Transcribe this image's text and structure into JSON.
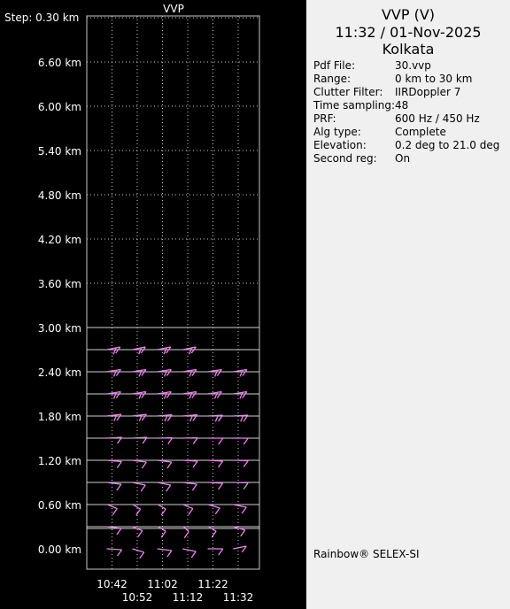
{
  "chart_data": {
    "type": "vvp_wind_barbs",
    "title": "VVP",
    "step_label": "Step: 0.30 km",
    "y_ticks": [
      "0.00 km",
      "0.60 km",
      "1.20 km",
      "1.80 km",
      "2.40 km",
      "3.00 km",
      "3.60 km",
      "4.20 km",
      "4.80 km",
      "5.40 km",
      "6.00 km",
      "6.60 km"
    ],
    "y_range_km": [
      0.0,
      7.2
    ],
    "x_ticks_top": [
      "10:42",
      "11:02",
      "11:22"
    ],
    "x_ticks_bottom": [
      "10:52",
      "11:12",
      "11:32"
    ],
    "times": [
      "10:42",
      "10:52",
      "11:02",
      "11:12",
      "11:22",
      "11:32"
    ],
    "heights_km": [
      0.0,
      0.3,
      0.6,
      0.9,
      1.2,
      1.5,
      1.8,
      2.1,
      2.4,
      2.7
    ],
    "barb_color": "#ee82ee",
    "grid": true,
    "wind_barbs": [
      {
        "time": "10:42",
        "height_km": 0.0,
        "dir_deg": 100,
        "barbs": 1
      },
      {
        "time": "10:52",
        "height_km": 0.0,
        "dir_deg": 130,
        "barbs": 1
      },
      {
        "time": "11:02",
        "height_km": 0.0,
        "dir_deg": 110,
        "barbs": 1
      },
      {
        "time": "11:12",
        "height_km": 0.0,
        "dir_deg": 120,
        "barbs": 1
      },
      {
        "time": "11:22",
        "height_km": 0.0,
        "dir_deg": 90,
        "barbs": 1
      },
      {
        "time": "11:32",
        "height_km": 0.0,
        "dir_deg": 60,
        "barbs": 1
      },
      {
        "time": "10:42",
        "height_km": 0.3,
        "dir_deg": 110,
        "barbs": 1
      },
      {
        "time": "10:52",
        "height_km": 0.3,
        "dir_deg": 140,
        "barbs": 1
      },
      {
        "time": "11:02",
        "height_km": 0.3,
        "dir_deg": 150,
        "barbs": 1
      },
      {
        "time": "11:12",
        "height_km": 0.3,
        "dir_deg": 160,
        "barbs": 1
      },
      {
        "time": "11:22",
        "height_km": 0.3,
        "dir_deg": 150,
        "barbs": 1
      },
      {
        "time": "11:32",
        "height_km": 0.3,
        "dir_deg": 130,
        "barbs": 1
      },
      {
        "time": "10:42",
        "height_km": 0.6,
        "dir_deg": 140,
        "barbs": 1
      },
      {
        "time": "10:52",
        "height_km": 0.6,
        "dir_deg": 150,
        "barbs": 1
      },
      {
        "time": "11:02",
        "height_km": 0.6,
        "dir_deg": 150,
        "barbs": 1
      },
      {
        "time": "11:12",
        "height_km": 0.6,
        "dir_deg": 140,
        "barbs": 1
      },
      {
        "time": "11:22",
        "height_km": 0.6,
        "dir_deg": 130,
        "barbs": 1
      },
      {
        "time": "11:32",
        "height_km": 0.6,
        "dir_deg": 120,
        "barbs": 1
      },
      {
        "time": "10:42",
        "height_km": 0.9,
        "dir_deg": 110,
        "barbs": 1
      },
      {
        "time": "10:52",
        "height_km": 0.9,
        "dir_deg": 120,
        "barbs": 1
      },
      {
        "time": "11:02",
        "height_km": 0.9,
        "dir_deg": 120,
        "barbs": 1
      },
      {
        "time": "11:12",
        "height_km": 0.9,
        "dir_deg": 110,
        "barbs": 1
      },
      {
        "time": "11:22",
        "height_km": 0.9,
        "dir_deg": 100,
        "barbs": 1
      },
      {
        "time": "11:32",
        "height_km": 0.9,
        "dir_deg": 95,
        "barbs": 1
      },
      {
        "time": "10:42",
        "height_km": 1.2,
        "dir_deg": 105,
        "barbs": 1
      },
      {
        "time": "10:52",
        "height_km": 1.2,
        "dir_deg": 110,
        "barbs": 1
      },
      {
        "time": "11:02",
        "height_km": 1.2,
        "dir_deg": 110,
        "barbs": 1
      },
      {
        "time": "11:12",
        "height_km": 1.2,
        "dir_deg": 100,
        "barbs": 1
      },
      {
        "time": "11:22",
        "height_km": 1.2,
        "dir_deg": 100,
        "barbs": 1
      },
      {
        "time": "11:32",
        "height_km": 1.2,
        "dir_deg": 95,
        "barbs": 1
      },
      {
        "time": "10:42",
        "height_km": 1.5,
        "dir_deg": 80,
        "barbs": 1
      },
      {
        "time": "10:52",
        "height_km": 1.5,
        "dir_deg": 80,
        "barbs": 1
      },
      {
        "time": "11:02",
        "height_km": 1.5,
        "dir_deg": 85,
        "barbs": 1
      },
      {
        "time": "11:12",
        "height_km": 1.5,
        "dir_deg": 85,
        "barbs": 1
      },
      {
        "time": "11:22",
        "height_km": 1.5,
        "dir_deg": 90,
        "barbs": 1
      },
      {
        "time": "11:32",
        "height_km": 1.5,
        "dir_deg": 90,
        "barbs": 1
      },
      {
        "time": "10:42",
        "height_km": 1.8,
        "dir_deg": 70,
        "barbs": 2
      },
      {
        "time": "10:52",
        "height_km": 1.8,
        "dir_deg": 70,
        "barbs": 2
      },
      {
        "time": "11:02",
        "height_km": 1.8,
        "dir_deg": 75,
        "barbs": 2
      },
      {
        "time": "11:12",
        "height_km": 1.8,
        "dir_deg": 75,
        "barbs": 2
      },
      {
        "time": "11:22",
        "height_km": 1.8,
        "dir_deg": 80,
        "barbs": 2
      },
      {
        "time": "11:32",
        "height_km": 1.8,
        "dir_deg": 80,
        "barbs": 2
      },
      {
        "time": "10:42",
        "height_km": 2.1,
        "dir_deg": 65,
        "barbs": 2
      },
      {
        "time": "10:52",
        "height_km": 2.1,
        "dir_deg": 65,
        "barbs": 2
      },
      {
        "time": "11:02",
        "height_km": 2.1,
        "dir_deg": 65,
        "barbs": 2
      },
      {
        "time": "11:12",
        "height_km": 2.1,
        "dir_deg": 65,
        "barbs": 2
      },
      {
        "time": "11:22",
        "height_km": 2.1,
        "dir_deg": 65,
        "barbs": 2
      },
      {
        "time": "11:32",
        "height_km": 2.1,
        "dir_deg": 65,
        "barbs": 2
      },
      {
        "time": "10:42",
        "height_km": 2.4,
        "dir_deg": 65,
        "barbs": 2
      },
      {
        "time": "10:52",
        "height_km": 2.4,
        "dir_deg": 65,
        "barbs": 2
      },
      {
        "time": "11:02",
        "height_km": 2.4,
        "dir_deg": 65,
        "barbs": 2
      },
      {
        "time": "11:12",
        "height_km": 2.4,
        "dir_deg": 65,
        "barbs": 2
      },
      {
        "time": "11:22",
        "height_km": 2.4,
        "dir_deg": 65,
        "barbs": 2
      },
      {
        "time": "11:32",
        "height_km": 2.4,
        "dir_deg": 65,
        "barbs": 2
      },
      {
        "time": "10:42",
        "height_km": 2.7,
        "dir_deg": 60,
        "barbs": 2
      },
      {
        "time": "10:52",
        "height_km": 2.7,
        "dir_deg": 60,
        "barbs": 2
      },
      {
        "time": "11:02",
        "height_km": 2.7,
        "dir_deg": 60,
        "barbs": 2
      },
      {
        "time": "11:12",
        "height_km": 2.7,
        "dir_deg": 60,
        "barbs": 2
      }
    ]
  },
  "info": {
    "title": "VVP (V)",
    "datetime": "11:32 / 01-Nov-2025",
    "location": "Kolkata",
    "rows": [
      {
        "key": "Pdf File:",
        "value": "30.vvp"
      },
      {
        "key": "Range:",
        "value": "0 km to 30 km"
      },
      {
        "key": "Clutter Filter:",
        "value": "IIRDoppler 7"
      },
      {
        "key": "Time sampling:",
        "value": "48"
      },
      {
        "key": "PRF:",
        "value": "600 Hz / 450 Hz"
      },
      {
        "key": "Alg type:",
        "value": "Complete"
      },
      {
        "key": "Elevation:",
        "value": "0.2 deg to 21.0 deg"
      },
      {
        "key": "Second reg:",
        "value": "On"
      }
    ],
    "footer": "Rainbow® SELEX-SI"
  }
}
